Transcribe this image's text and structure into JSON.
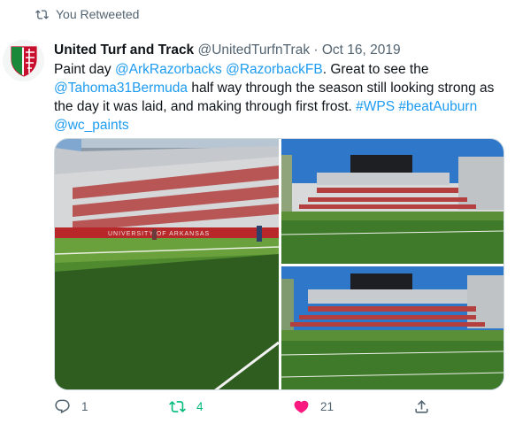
{
  "retweet": {
    "label": "You Retweeted"
  },
  "author": {
    "name": "United Turf and Track",
    "handle": "@UnitedTurfnTrak",
    "separator": "·",
    "date": "Oct 16, 2019"
  },
  "tweet": {
    "segments": [
      {
        "text": "Paint day ",
        "link": false
      },
      {
        "text": "@ArkRazorbacks",
        "link": true
      },
      {
        "text": " ",
        "link": false
      },
      {
        "text": "@RazorbackFB",
        "link": true
      },
      {
        "text": ".  Great to see the ",
        "link": false
      },
      {
        "text": "@Tahoma31Bermuda",
        "link": true
      },
      {
        "text": " half way through the season still looking strong as the day it was laid, and making through first frost. ",
        "link": false
      },
      {
        "text": "#WPS",
        "link": true
      },
      {
        "text": " ",
        "link": false
      },
      {
        "text": "#beatAuburn",
        "link": true
      },
      {
        "text": " ",
        "link": false
      },
      {
        "text": "@wc_paints",
        "link": true
      }
    ]
  },
  "media": {
    "photos": [
      {
        "name": "photo-stadium-sideline",
        "stadium_sign": "UNIVERSITY OF ARKANSAS"
      },
      {
        "name": "photo-stadium-field-1"
      },
      {
        "name": "photo-stadium-field-2"
      }
    ]
  },
  "actions": {
    "reply_count": "1",
    "retweet_count": "4",
    "like_count": "21"
  },
  "colors": {
    "link": "#1d9bf0",
    "muted": "#536471",
    "retweet_active": "#00ba7c",
    "like_active": "#f91880"
  }
}
